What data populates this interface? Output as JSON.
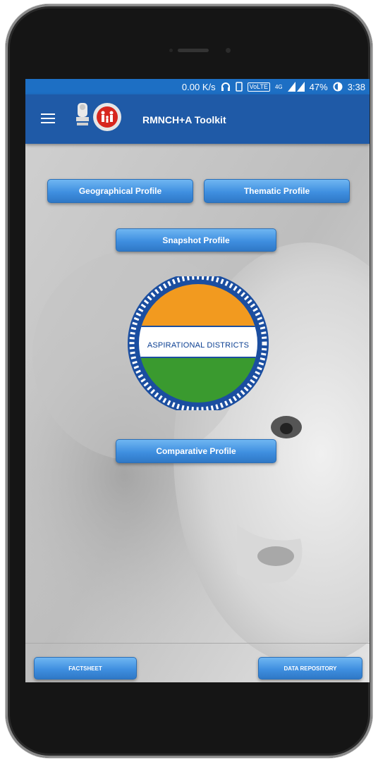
{
  "status_bar": {
    "speed": "0.00 K/s",
    "volte": "VoLTE",
    "network": "4G",
    "battery": "47%",
    "time": "3:38"
  },
  "app_bar": {
    "title": "RMNCH+A Toolkit"
  },
  "profile_buttons": {
    "geographical": "Geographical Profile",
    "thematic": "Thematic Profile",
    "snapshot": "Snapshot Profile",
    "comparative": "Comparative Profile"
  },
  "badge": {
    "label": "ASPIRATIONAL DISTRICTS"
  },
  "footer": {
    "factsheet": "FACTSHEET",
    "data_repository": "DATA REPOSITORY"
  },
  "colors": {
    "status_bar": "#1d6fc4",
    "app_bar": "#1f5aa7",
    "button": "#3f8fe0",
    "saffron": "#f29a1f",
    "green": "#3a9a2f",
    "badge_text": "#0b3f92"
  },
  "icons": [
    "menu-icon",
    "headset-icon",
    "phone-icon",
    "signal-icon",
    "battery-icon"
  ]
}
